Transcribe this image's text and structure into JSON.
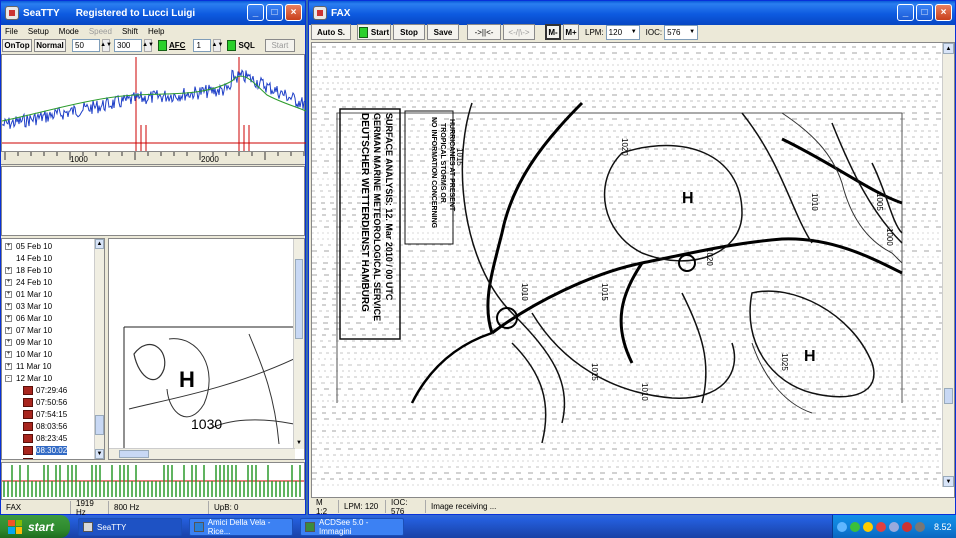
{
  "seatty": {
    "title": "SeaTTY",
    "registered": "Registered to Lucci Luigi",
    "menu": [
      "File",
      "Setup",
      "Mode",
      "Speed",
      "Shift",
      "Help"
    ],
    "menu_disabled": [
      false,
      false,
      false,
      true,
      false,
      false
    ],
    "toolbar": {
      "ontop": "OnTop",
      "normal": "Normal",
      "val1": "50",
      "val2": "300",
      "afc": "AFC",
      "val3": "1",
      "sql": "SQL",
      "start": "Start"
    },
    "freq_ticks": [
      "1000",
      "2000"
    ],
    "tree": [
      {
        "label": "05 Feb 10",
        "type": "date",
        "expander": "+"
      },
      {
        "label": "14 Feb 10",
        "type": "date",
        "expander": ""
      },
      {
        "label": "18 Feb 10",
        "type": "date",
        "expander": "+"
      },
      {
        "label": "24 Feb 10",
        "type": "date",
        "expander": "+"
      },
      {
        "label": "01 Mar 10",
        "type": "date",
        "expander": "+"
      },
      {
        "label": "03 Mar 10",
        "type": "date",
        "expander": "+"
      },
      {
        "label": "06 Mar 10",
        "type": "date",
        "expander": "+"
      },
      {
        "label": "07 Mar 10",
        "type": "date",
        "expander": "+"
      },
      {
        "label": "09 Mar 10",
        "type": "date",
        "expander": "+"
      },
      {
        "label": "10 Mar 10",
        "type": "date",
        "expander": "+"
      },
      {
        "label": "11 Mar 10",
        "type": "date",
        "expander": "+"
      },
      {
        "label": "12 Mar 10",
        "type": "date",
        "expander": "-"
      },
      {
        "label": "07:29:46",
        "type": "file"
      },
      {
        "label": "07:50:56",
        "type": "file"
      },
      {
        "label": "07:54:15",
        "type": "file"
      },
      {
        "label": "08:03:56",
        "type": "file"
      },
      {
        "label": "08:23:45",
        "type": "file"
      },
      {
        "label": "08:30:02",
        "type": "file",
        "selected": true
      },
      {
        "label": "08:38:22",
        "type": "file"
      }
    ],
    "preview_label": "1030",
    "preview_h": "H",
    "status": [
      "FAX",
      "1919 Hz",
      "800 Hz",
      "UpB: 0"
    ]
  },
  "fax": {
    "title": "FAX",
    "toolbar": {
      "auto": "Auto S.",
      "start": "Start",
      "stop": "Stop",
      "save": "Save",
      "fwd": "->||<-",
      "back": "<-/|\\->",
      "mminus": "M-",
      "mplus": "M+",
      "lpm_label": "LPM:",
      "lpm_value": "120",
      "ioc_label": "IOC:",
      "ioc_value": "576"
    },
    "chart_text": {
      "header_l1": "DEUTSCHER WETTERDIENST HAMBURG",
      "header_l2": "GERMAN MARINE METEOROLOGICAL SERVICE",
      "header_l3": "SURFACE ANALYSIS: 12. Mar 2010 / 00 UTC",
      "note_l1": "NO INFORMATION CONCERNING",
      "note_l2": "TROPICAL STORMS OR",
      "note_l3": "HURRICANES AT PRESENT",
      "isobars": [
        "1015",
        "1020",
        "1010",
        "1015",
        "1020",
        "1015",
        "1010",
        "1025",
        "1005",
        "1000",
        "1010"
      ],
      "highs": [
        "H",
        "H"
      ]
    },
    "status": [
      "M 1:2",
      "LPM: 120",
      "IOC: 576",
      "Image receiving ..."
    ]
  },
  "taskbar": {
    "start": "start",
    "tasks": [
      "SeaTTY",
      "Amici Della Vela - Rice...",
      "ACDSee 5.0 - Immagini"
    ],
    "clock": "8.52"
  }
}
